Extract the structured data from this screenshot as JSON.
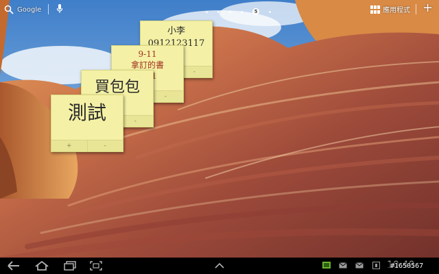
{
  "topbar": {
    "search_label": "Google",
    "apps_label": "應用程式",
    "page_indicator": "5",
    "add_label": "+"
  },
  "notes": [
    {
      "text": "小李\n0912123117"
    },
    {
      "text": "9-11\n拿訂的書\n9/11"
    },
    {
      "text": "買包包"
    },
    {
      "text": "測試"
    }
  ],
  "note_buttons": {
    "plus": "+",
    "minus": "-"
  },
  "statusbar": {
    "clock": "10:40",
    "watermark": "#1650567",
    "accent": "#69b42e"
  }
}
